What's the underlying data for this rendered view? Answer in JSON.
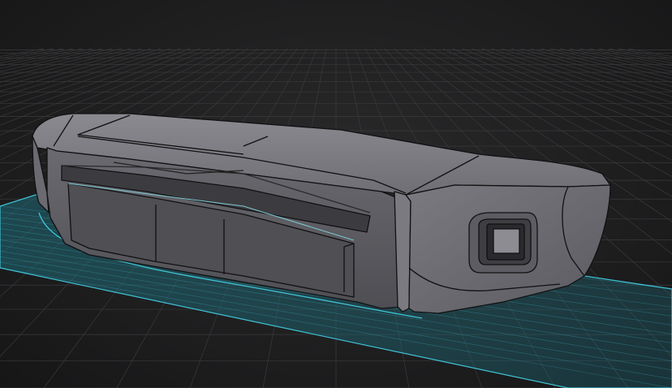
{
  "viewport": {
    "name": "3d-modeling-viewport",
    "background_color": "#1d1d1e",
    "grid_color": "#3a3a3c",
    "construction_plane_color": "#3fc3d6",
    "model_fill_color": "#6d6d72",
    "model_edge_color": "#111113"
  },
  "model": {
    "name": "front-bumper-mesh",
    "parts": [
      "bumper-top-shell",
      "bumper-front-face",
      "grille-slot",
      "lower-intake-panels",
      "corner-housing",
      "fog-lamp-bezel",
      "fog-lamp-lens"
    ]
  }
}
